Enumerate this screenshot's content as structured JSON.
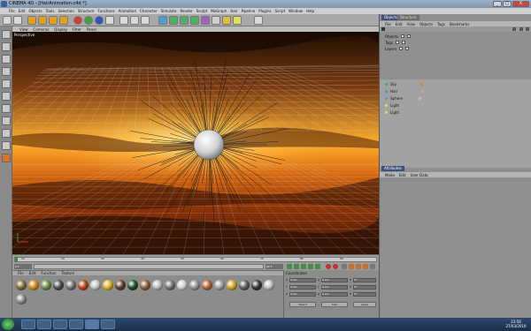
{
  "window": {
    "title": "CINEMA 4D - [HairAnimation.c4d *]",
    "controls": [
      "_",
      "□",
      "X"
    ]
  },
  "menubar": [
    "File",
    "Edit",
    "Objects",
    "Tools",
    "Selection",
    "Structure",
    "Functions",
    "Animation",
    "Character",
    "Simulate",
    "Render",
    "Sculpt",
    "MoGraph",
    "Hair",
    "Pipeline",
    "Plugins",
    "Script",
    "Window",
    "Help"
  ],
  "viewport": {
    "menu": [
      "View",
      "Cameras",
      "Display",
      "Filter",
      "Panel"
    ],
    "label": "Perspective",
    "colors": {
      "sky_top": "#2a1404",
      "sky_mid": "#d96a10",
      "sky_bright": "#ffc040",
      "grid": "#d8d8d8",
      "hair": "#111111",
      "sphere": "#e8e8e8"
    }
  },
  "timeline": {
    "start_frame": "0 F",
    "end_frame": "90 F",
    "ticks": [
      "0",
      "10",
      "20",
      "30",
      "40",
      "50",
      "60",
      "70",
      "80",
      "90"
    ]
  },
  "materials": {
    "menu": [
      "File",
      "Edit",
      "Function",
      "Texture"
    ],
    "swatches": [
      "#7a6a3a",
      "#c88a10",
      "#6a8a40",
      "#4a4a4a",
      "#707070",
      "#b04010",
      "#c0c0c0",
      "#e0b020",
      "#5a3a20",
      "#1a4a2a",
      "#8a5a30",
      "#b8b8b8",
      "#707070",
      "#cccccc",
      "#909090",
      "#b06030",
      "#a0a0a0",
      "#d0a020",
      "#5a5a5a",
      "#303030",
      "#c0c0c0",
      "#8a8a8a"
    ]
  },
  "coordinates": {
    "title": "Coordinates",
    "rows": [
      [
        "X",
        "0 cm",
        "X",
        "0 cm",
        "H",
        "0 °"
      ],
      [
        "Y",
        "0 cm",
        "Y",
        "0 cm",
        "P",
        "0 °"
      ],
      [
        "Z",
        "0 cm",
        "Z",
        "0 cm",
        "B",
        "0 °"
      ]
    ],
    "mode": "Object",
    "size_mode": "Size",
    "apply": "Apply"
  },
  "objects_panel": {
    "tabs": [
      "Objects",
      "Structure"
    ],
    "menu": [
      "File",
      "Edit",
      "View",
      "Objects",
      "Tags",
      "Bookmarks"
    ],
    "filters": [
      "Objects",
      "Tags",
      "Layers"
    ],
    "items": [
      "Sky",
      "Hair",
      "Sphere",
      "Light",
      "Light"
    ]
  },
  "attributes_panel": {
    "tabs": [
      "Attributes"
    ],
    "menu": [
      "Mode",
      "Edit",
      "User Data"
    ]
  },
  "taskbar": {
    "time": "23:58",
    "date": "27/03/2010"
  }
}
